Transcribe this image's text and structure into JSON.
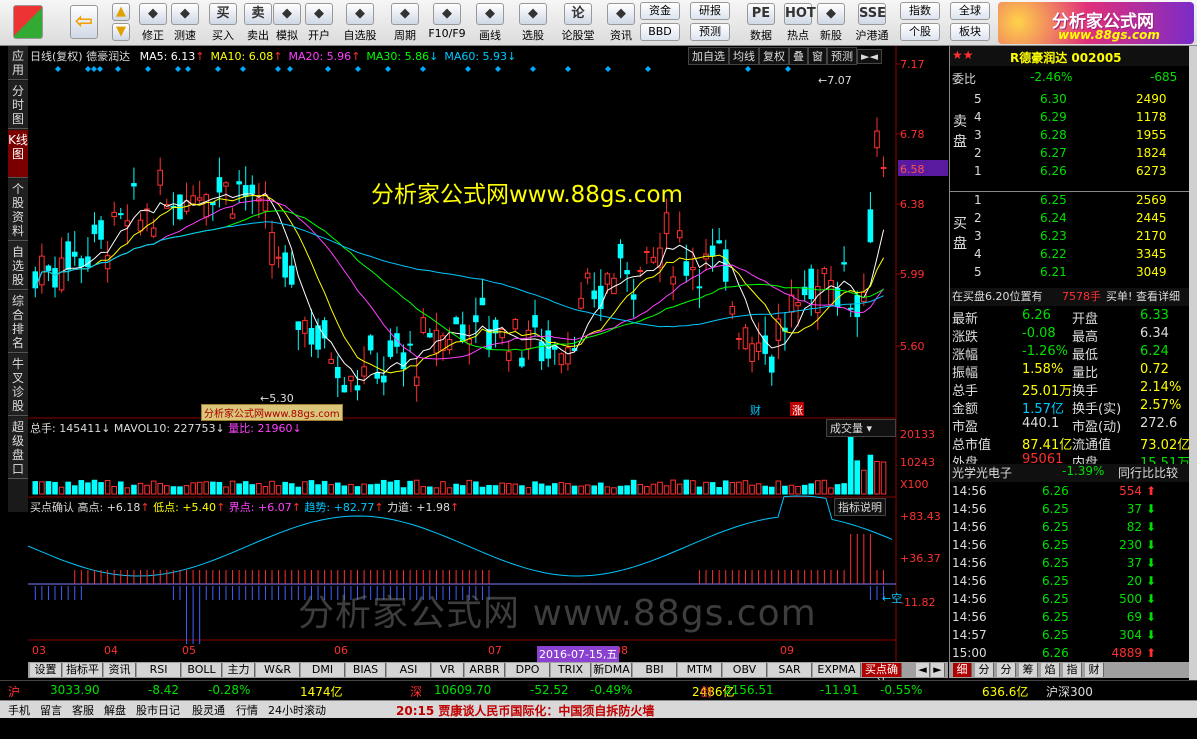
{
  "toolbar": {
    "buttons": [
      {
        "label": "修正",
        "icon": "pencil-icon"
      },
      {
        "label": "测速",
        "icon": "clock-icon"
      },
      {
        "label": "买入",
        "icon": "buy-icon",
        "glyph": "买"
      },
      {
        "label": "卖出",
        "icon": "sell-icon",
        "glyph": "卖"
      },
      {
        "label": "模拟",
        "icon": "hammer-icon"
      },
      {
        "label": "开户",
        "icon": "lock-icon"
      },
      {
        "label": "自选股",
        "icon": "star-icon"
      },
      {
        "label": "周期",
        "icon": "clock-icon"
      },
      {
        "label": "F10/F9",
        "icon": "document-icon"
      },
      {
        "label": "画线",
        "icon": "pen-icon"
      },
      {
        "label": "选股",
        "icon": "screen-icon"
      },
      {
        "label": "论股堂",
        "icon": "chat-icon",
        "glyph": "论"
      },
      {
        "label": "资讯",
        "icon": "info-icon"
      },
      {
        "label": "数据",
        "icon": "pe-icon",
        "glyph": "PE"
      },
      {
        "label": "热点",
        "icon": "hot-icon",
        "glyph": "HOT"
      },
      {
        "label": "新股",
        "icon": "newstock-icon"
      },
      {
        "label": "沪港通",
        "icon": "hk-icon",
        "glyph": "SSE"
      }
    ],
    "small_buttons": [
      "资金",
      "BBD",
      "研报",
      "预测",
      "指数",
      "个股",
      "全球",
      "板块"
    ]
  },
  "logo": {
    "line1": "分析家公式网",
    "line2": "www.88gs.com"
  },
  "sidenav": [
    "应用",
    "分时图",
    "K线图",
    "个股资料",
    "自选股",
    "综合排名",
    "牛叉诊股",
    "超级盘口"
  ],
  "chart": {
    "title": "日线(复权)",
    "stock": "德豪润达",
    "ma": [
      {
        "label": "MA5: 6.13",
        "color": "#ffffff"
      },
      {
        "label": "MA10: 6.08",
        "color": "#ffff00"
      },
      {
        "label": "MA20: 5.96",
        "color": "#ff40ff"
      },
      {
        "label": "MA30: 5.86",
        "color": "#00ff00"
      },
      {
        "label": "MA60: 5.93",
        "color": "#00c8ff"
      }
    ],
    "buttons": [
      "加自选",
      "均线",
      "复权",
      "叠",
      "窗",
      "预测"
    ],
    "price_ticks": [
      "7.17",
      "6.78",
      "6.38",
      "5.99",
      "5.60"
    ],
    "current_price": "6.58",
    "high_label": "7.07",
    "low_label": "5.30",
    "event_labels": [
      "财",
      "涨"
    ],
    "vol_header": {
      "total": "总手: 145411",
      "mavol": "MAVOL10: 227753",
      "qb": "量比: 21960"
    },
    "vol_dropdown": "成交量",
    "vol_ticks": [
      "20133",
      "10243",
      "X100"
    ],
    "ind_header": {
      "name": "买点确认",
      "high": "高点: +6.18",
      "low": "低点: +5.40",
      "bound": "界点: +6.07",
      "trend": "趋势: +82.77",
      "force": "力道: +1.98"
    },
    "ind_button": "指标说明",
    "ind_ticks": [
      "+83.43",
      "+36.37",
      "-11.82"
    ],
    "ind_mark": "空",
    "months": [
      "03",
      "04",
      "05",
      "06",
      "07",
      "08",
      "09"
    ],
    "date_tag": "2016-07-15,五"
  },
  "watermarks": {
    "big": "分析家公式网www.88gs.com",
    "small": "分析家公式网www.88gs.com",
    "gray": "分析家公式网 www.88gs.com"
  },
  "ind_tabs": [
    "设置",
    "指标平台",
    "资讯",
    "RSI",
    "BOLL",
    "主力",
    "W&R",
    "DMI",
    "BIAS",
    "ASI",
    "VR",
    "ARBR",
    "DPO",
    "TRIX",
    "新DMA",
    "BBI",
    "MTM",
    "OBV",
    "SAR",
    "EXPMA",
    "买点确认"
  ],
  "panel": {
    "header": "R德豪润达 002005",
    "weibi": {
      "label": "委比",
      "pct": "-2.46%",
      "val": "-685"
    },
    "sell": [
      {
        "lv": "5",
        "p": "6.30",
        "v": "2490"
      },
      {
        "lv": "4",
        "p": "6.29",
        "v": "1178"
      },
      {
        "lv": "3",
        "p": "6.28",
        "v": "1955"
      },
      {
        "lv": "2",
        "p": "6.27",
        "v": "1824"
      },
      {
        "lv": "1",
        "p": "6.26",
        "v": "6273"
      }
    ],
    "buy": [
      {
        "lv": "1",
        "p": "6.25",
        "v": "2569"
      },
      {
        "lv": "2",
        "p": "6.24",
        "v": "2445"
      },
      {
        "lv": "3",
        "p": "6.23",
        "v": "2170"
      },
      {
        "lv": "4",
        "p": "6.22",
        "v": "3345"
      },
      {
        "lv": "5",
        "p": "6.21",
        "v": "3049"
      }
    ],
    "sell_label": "卖盘",
    "buy_label": "买盘",
    "notice": {
      "a": "在买盘6.20位置有",
      "b": "7578手",
      "c": "买单!",
      "d": "查看详细"
    },
    "stats": [
      {
        "l1": "最新",
        "v1": "6.26",
        "c1": "green",
        "l2": "开盘",
        "v2": "6.33",
        "c2": "green"
      },
      {
        "l1": "涨跌",
        "v1": "-0.08",
        "c1": "green",
        "l2": "最高",
        "v2": "6.34",
        "c2": "white"
      },
      {
        "l1": "涨幅",
        "v1": "-1.26%",
        "c1": "green",
        "l2": "最低",
        "v2": "6.24",
        "c2": "green"
      },
      {
        "l1": "振幅",
        "v1": "1.58%",
        "c1": "yellow",
        "l2": "量比",
        "v2": "0.72",
        "c2": "yellow"
      },
      {
        "l1": "总手",
        "v1": "25.01万",
        "c1": "yellow",
        "l2": "换手",
        "v2": "2.14%",
        "c2": "yellow"
      },
      {
        "l1": "金额",
        "v1": "1.57亿",
        "c1": "cyan",
        "l2": "换手(实)",
        "v2": "2.57%",
        "c2": "yellow"
      },
      {
        "l1": "市盈",
        "v1": "440.1",
        "c1": "white",
        "l2": "市盈(动)",
        "v2": "272.6",
        "c2": "white"
      },
      {
        "l1": "总市值",
        "v1": "87.41亿",
        "c1": "yellow",
        "l2": "流通值",
        "v2": "73.02亿",
        "c2": "yellow"
      },
      {
        "l1": "外盘",
        "v1": "95061",
        "c1": "red",
        "l2": "内盘",
        "v2": "15.51万",
        "c2": "green"
      }
    ],
    "sector": {
      "name": "光学光电子",
      "pct": "-1.39%",
      "cmp": "同行比比较"
    },
    "ticks": [
      {
        "t": "14:56",
        "p": "6.26",
        "v": "554",
        "d": "up"
      },
      {
        "t": "14:56",
        "p": "6.25",
        "v": "37",
        "d": "down"
      },
      {
        "t": "14:56",
        "p": "6.25",
        "v": "82",
        "d": "down"
      },
      {
        "t": "14:56",
        "p": "6.25",
        "v": "230",
        "d": "down"
      },
      {
        "t": "14:56",
        "p": "6.25",
        "v": "37",
        "d": "down"
      },
      {
        "t": "14:56",
        "p": "6.25",
        "v": "20",
        "d": "down"
      },
      {
        "t": "14:56",
        "p": "6.25",
        "v": "500",
        "d": "down"
      },
      {
        "t": "14:56",
        "p": "6.25",
        "v": "69",
        "d": "down"
      },
      {
        "t": "14:57",
        "p": "6.25",
        "v": "304",
        "d": "down"
      },
      {
        "t": "15:00",
        "p": "6.26",
        "v": "4889",
        "d": "up"
      }
    ],
    "tabs": [
      "细",
      "分",
      "分",
      "筹",
      "焰",
      "指",
      "财"
    ]
  },
  "status": [
    {
      "name": "沪",
      "idx": "3033.90",
      "chg": "-8.42",
      "pct": "-0.28%",
      "amt": "1474亿"
    },
    {
      "name": "深",
      "idx": "10609.70",
      "chg": "-52.52",
      "pct": "-0.49%",
      "amt": "2486亿"
    },
    {
      "name": "创",
      "idx": "2156.51",
      "chg": "-11.91",
      "pct": "-0.55%",
      "amt": "636.6亿"
    }
  ],
  "status_tail": "沪深300",
  "bottom": {
    "items": [
      "手机",
      "留言",
      "客服",
      "解盘",
      "股市日记",
      "股灵通",
      "行情",
      "24小时滚动"
    ],
    "news": "20:15 贾康谈人民币国际化：中国须自拆防火墙"
  }
}
